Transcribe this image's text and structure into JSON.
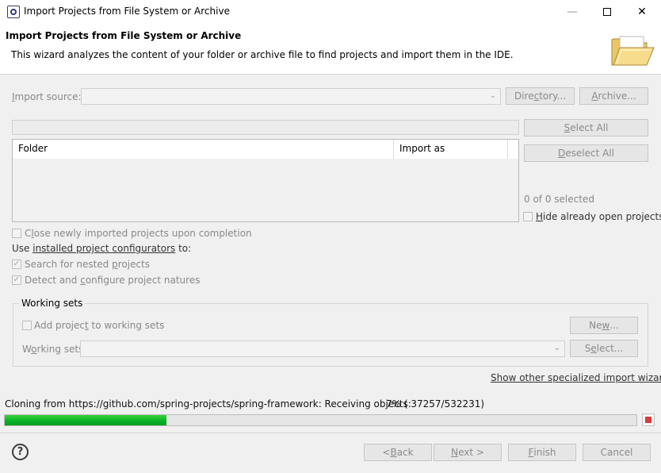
{
  "window": {
    "title": "Import Projects from File System or Archive",
    "minimize_glyph": "—",
    "close_glyph": "✕"
  },
  "header": {
    "title": "Import Projects from File System or Archive",
    "description": "This wizard analyzes the content of your folder or archive file to find projects and import them in the IDE.",
    "icon": "open-folder-icon"
  },
  "source": {
    "label_mnemonic": "I",
    "label_rest": "mport source:",
    "value": "",
    "directory_pre": "Dire",
    "directory_mnemonic": "c",
    "directory_post": "tory...",
    "archive_mnemonic": "A",
    "archive_rest": "rchive..."
  },
  "table": {
    "columns": [
      "Folder",
      "Import as"
    ],
    "rows": []
  },
  "selection": {
    "select_all_mnemonic": "S",
    "select_all_rest": "elect All",
    "deselect_all_mnemonic": "D",
    "deselect_all_rest": "eselect All",
    "count": "0 of 0 selected",
    "hide_open_mnemonic": "H",
    "hide_open_rest": "ide already open projects"
  },
  "options": {
    "close_pre": "C",
    "close_mnemonic": "l",
    "close_post": "ose newly imported projects upon completion",
    "use_pre": "Use ",
    "use_link": "installed project configurators",
    "use_post": " to:",
    "nested_pre": "Search for nested ",
    "nested_mnemonic": "p",
    "nested_post": "rojects",
    "natures_pre": "Detect and ",
    "natures_mnemonic": "c",
    "natures_post": "onfigure project natures"
  },
  "working_sets": {
    "group_label": "Working sets",
    "add_pre": "Add projec",
    "add_mnemonic": "t",
    "add_post": " to working sets",
    "label_pre": "W",
    "label_mnemonic": "o",
    "label_post": "rking sets:",
    "value": "",
    "new_pre": "Ne",
    "new_mnemonic": "w",
    "new_post": "...",
    "select_pre": "S",
    "select_mnemonic": "e",
    "select_post": "lect..."
  },
  "other_wizards_link": "Show other specialized import wizards",
  "progress": {
    "text": "Cloning from https://github.com/spring-projects/spring-framework: Receiving objects:",
    "percent_text": "7% ( 37257/532231)",
    "fraction": 0.256
  },
  "footer": {
    "help_glyph": "?",
    "back_pre": "< ",
    "back_mnemonic": "B",
    "back_post": "ack",
    "next_mnemonic": "N",
    "next_post": "ext >",
    "finish_mnemonic": "F",
    "finish_post": "inish",
    "cancel": "Cancel"
  }
}
